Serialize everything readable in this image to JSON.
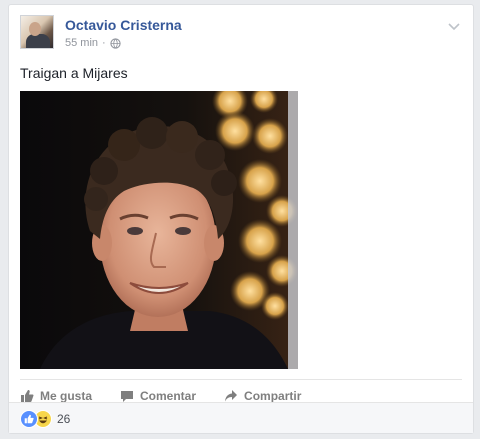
{
  "post": {
    "author": "Octavio Cristerna",
    "time": "55 min",
    "separator": "·",
    "text": "Traigan a Mijares"
  },
  "actions": {
    "like": "Me gusta",
    "comment": "Comentar",
    "share": "Compartir"
  },
  "reactions": {
    "count": "26",
    "types": [
      "like-icon",
      "haha-icon"
    ]
  },
  "colors": {
    "author_link": "#365899",
    "meta": "#90949c",
    "action_text": "#7f7f7f",
    "like_badge": "#5890ff",
    "haha_badge": "#f7d64b",
    "background": "#e9ebee"
  }
}
